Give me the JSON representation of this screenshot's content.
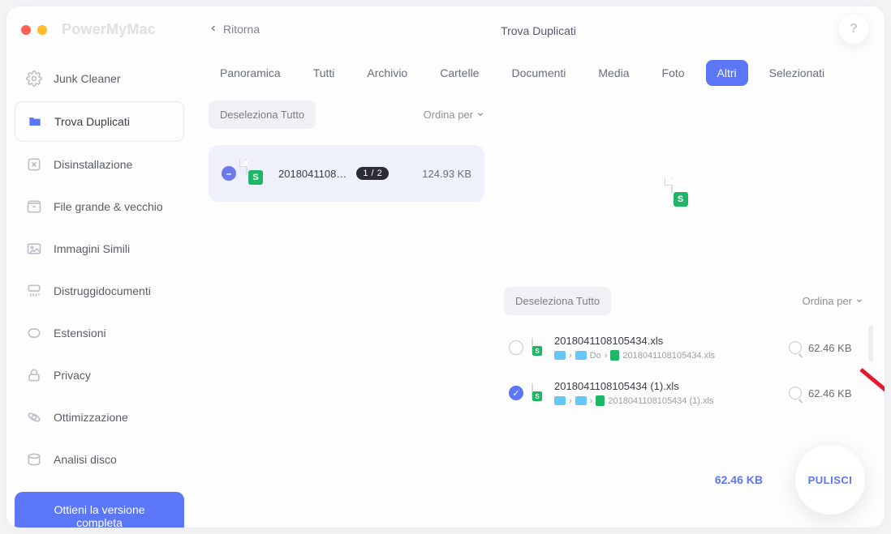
{
  "brand": "PowerMyMac",
  "header": {
    "back": "Ritorna",
    "title": "Trova Duplicati",
    "help": "?"
  },
  "sidebar": {
    "items": [
      {
        "label": "Junk Cleaner"
      },
      {
        "label": "Trova Duplicati"
      },
      {
        "label": "Disinstallazione"
      },
      {
        "label": "File grande & vecchio"
      },
      {
        "label": "Immagini Simili"
      },
      {
        "label": "Distruggidocumenti"
      },
      {
        "label": "Estensioni"
      },
      {
        "label": "Privacy"
      },
      {
        "label": "Ottimizzazione"
      },
      {
        "label": "Analisi disco"
      }
    ],
    "cta": "Ottieni la versione completa"
  },
  "tabs": {
    "items": [
      "Panoramica",
      "Tutti",
      "Archivio",
      "Cartelle",
      "Documenti",
      "Media",
      "Foto",
      "Altri",
      "Selezionati"
    ],
    "activeIndex": 7
  },
  "left": {
    "deselect": "Deseleziona Tutto",
    "sort": "Ordina per",
    "card": {
      "name": "2018041108…",
      "badge": "1 / 2",
      "size": "124.93 KB"
    }
  },
  "right": {
    "deselect": "Deseleziona Tutto",
    "sort": "Ordina per",
    "files": [
      {
        "checked": false,
        "name": "2018041108105434.xls",
        "pathSegments": [
          "",
          "Do",
          "2018041108105434.xls"
        ],
        "size": "62.46 KB"
      },
      {
        "checked": true,
        "name": "2018041108105434 (1).xls",
        "pathSegments": [
          "",
          "",
          "2018041108105434 (1).xls"
        ],
        "size": "62.46 KB"
      }
    ]
  },
  "footer": {
    "totalSize": "62.46 KB",
    "clean": "PULISCI"
  }
}
